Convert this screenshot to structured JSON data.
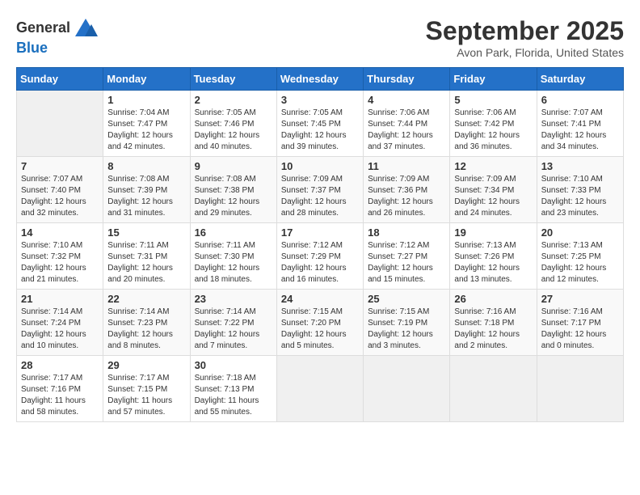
{
  "logo": {
    "general": "General",
    "blue": "Blue"
  },
  "title": "September 2025",
  "subtitle": "Avon Park, Florida, United States",
  "days_of_week": [
    "Sunday",
    "Monday",
    "Tuesday",
    "Wednesday",
    "Thursday",
    "Friday",
    "Saturday"
  ],
  "weeks": [
    [
      {
        "day": "",
        "info": ""
      },
      {
        "day": "1",
        "info": "Sunrise: 7:04 AM\nSunset: 7:47 PM\nDaylight: 12 hours and 42 minutes."
      },
      {
        "day": "2",
        "info": "Sunrise: 7:05 AM\nSunset: 7:46 PM\nDaylight: 12 hours and 40 minutes."
      },
      {
        "day": "3",
        "info": "Sunrise: 7:05 AM\nSunset: 7:45 PM\nDaylight: 12 hours and 39 minutes."
      },
      {
        "day": "4",
        "info": "Sunrise: 7:06 AM\nSunset: 7:44 PM\nDaylight: 12 hours and 37 minutes."
      },
      {
        "day": "5",
        "info": "Sunrise: 7:06 AM\nSunset: 7:42 PM\nDaylight: 12 hours and 36 minutes."
      },
      {
        "day": "6",
        "info": "Sunrise: 7:07 AM\nSunset: 7:41 PM\nDaylight: 12 hours and 34 minutes."
      }
    ],
    [
      {
        "day": "7",
        "info": "Sunrise: 7:07 AM\nSunset: 7:40 PM\nDaylight: 12 hours and 32 minutes."
      },
      {
        "day": "8",
        "info": "Sunrise: 7:08 AM\nSunset: 7:39 PM\nDaylight: 12 hours and 31 minutes."
      },
      {
        "day": "9",
        "info": "Sunrise: 7:08 AM\nSunset: 7:38 PM\nDaylight: 12 hours and 29 minutes."
      },
      {
        "day": "10",
        "info": "Sunrise: 7:09 AM\nSunset: 7:37 PM\nDaylight: 12 hours and 28 minutes."
      },
      {
        "day": "11",
        "info": "Sunrise: 7:09 AM\nSunset: 7:36 PM\nDaylight: 12 hours and 26 minutes."
      },
      {
        "day": "12",
        "info": "Sunrise: 7:09 AM\nSunset: 7:34 PM\nDaylight: 12 hours and 24 minutes."
      },
      {
        "day": "13",
        "info": "Sunrise: 7:10 AM\nSunset: 7:33 PM\nDaylight: 12 hours and 23 minutes."
      }
    ],
    [
      {
        "day": "14",
        "info": "Sunrise: 7:10 AM\nSunset: 7:32 PM\nDaylight: 12 hours and 21 minutes."
      },
      {
        "day": "15",
        "info": "Sunrise: 7:11 AM\nSunset: 7:31 PM\nDaylight: 12 hours and 20 minutes."
      },
      {
        "day": "16",
        "info": "Sunrise: 7:11 AM\nSunset: 7:30 PM\nDaylight: 12 hours and 18 minutes."
      },
      {
        "day": "17",
        "info": "Sunrise: 7:12 AM\nSunset: 7:29 PM\nDaylight: 12 hours and 16 minutes."
      },
      {
        "day": "18",
        "info": "Sunrise: 7:12 AM\nSunset: 7:27 PM\nDaylight: 12 hours and 15 minutes."
      },
      {
        "day": "19",
        "info": "Sunrise: 7:13 AM\nSunset: 7:26 PM\nDaylight: 12 hours and 13 minutes."
      },
      {
        "day": "20",
        "info": "Sunrise: 7:13 AM\nSunset: 7:25 PM\nDaylight: 12 hours and 12 minutes."
      }
    ],
    [
      {
        "day": "21",
        "info": "Sunrise: 7:14 AM\nSunset: 7:24 PM\nDaylight: 12 hours and 10 minutes."
      },
      {
        "day": "22",
        "info": "Sunrise: 7:14 AM\nSunset: 7:23 PM\nDaylight: 12 hours and 8 minutes."
      },
      {
        "day": "23",
        "info": "Sunrise: 7:14 AM\nSunset: 7:22 PM\nDaylight: 12 hours and 7 minutes."
      },
      {
        "day": "24",
        "info": "Sunrise: 7:15 AM\nSunset: 7:20 PM\nDaylight: 12 hours and 5 minutes."
      },
      {
        "day": "25",
        "info": "Sunrise: 7:15 AM\nSunset: 7:19 PM\nDaylight: 12 hours and 3 minutes."
      },
      {
        "day": "26",
        "info": "Sunrise: 7:16 AM\nSunset: 7:18 PM\nDaylight: 12 hours and 2 minutes."
      },
      {
        "day": "27",
        "info": "Sunrise: 7:16 AM\nSunset: 7:17 PM\nDaylight: 12 hours and 0 minutes."
      }
    ],
    [
      {
        "day": "28",
        "info": "Sunrise: 7:17 AM\nSunset: 7:16 PM\nDaylight: 11 hours and 58 minutes."
      },
      {
        "day": "29",
        "info": "Sunrise: 7:17 AM\nSunset: 7:15 PM\nDaylight: 11 hours and 57 minutes."
      },
      {
        "day": "30",
        "info": "Sunrise: 7:18 AM\nSunset: 7:13 PM\nDaylight: 11 hours and 55 minutes."
      },
      {
        "day": "",
        "info": ""
      },
      {
        "day": "",
        "info": ""
      },
      {
        "day": "",
        "info": ""
      },
      {
        "day": "",
        "info": ""
      }
    ]
  ]
}
